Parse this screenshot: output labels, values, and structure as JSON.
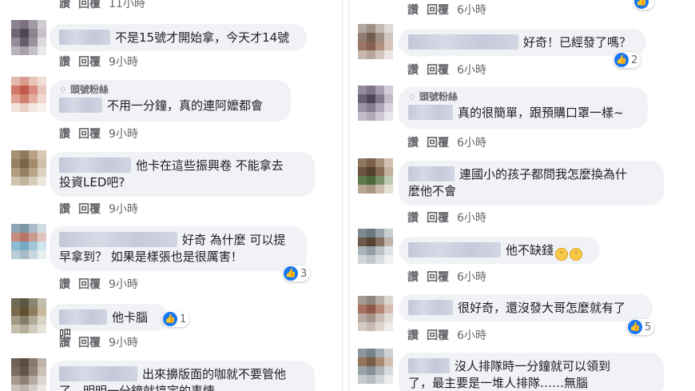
{
  "common": {
    "like": "讚",
    "reply": "回覆",
    "fan_badge": "頭號粉絲"
  },
  "left_column": {
    "top_partial": {
      "time": "11小時"
    },
    "comments": [
      {
        "text": "不是15號才開始拿，今天才14號",
        "time": "9小時"
      },
      {
        "text": "不用一分鐘，真的連阿嬤都會",
        "time": "9小時",
        "badge": true
      },
      {
        "line1": "他卡在這些振興卷 不能拿去",
        "line2": "投資LED吧?",
        "time": "9小時"
      },
      {
        "line1": "好奇 為什麼 可以提",
        "line2": "早拿到？ 如果是樣張也是很厲害！",
        "time": "9小時",
        "reactions": "3"
      },
      {
        "text": "他卡腦吧",
        "time": "9小時",
        "reactions": "1"
      },
      {
        "line1": "出來擤版面的咖就不要管他",
        "line2": "了，明明一分鐘就搞定的事情"
      }
    ]
  },
  "right_column": {
    "top_partial": {
      "time": "6小時"
    },
    "comments": [
      {
        "text": "好奇！已經發了嗎？",
        "time": "6小時",
        "reactions": "2"
      },
      {
        "text": "真的很簡單，跟預購口罩一樣~",
        "time": "6小時",
        "badge": true
      },
      {
        "line1": "連國小的孩子都問我怎麼換為什",
        "line2": "麼他不會",
        "time": "6小時"
      },
      {
        "text": "他不缺錢",
        "time": "6小時"
      },
      {
        "text": "很好奇，還沒發大哥怎麼就有了",
        "time": "6小時",
        "reactions": "5"
      },
      {
        "line1": "沒人排隊時一分鐘就可以領到",
        "line2": "了，最主要是一堆人排隊……無腦"
      }
    ]
  },
  "avatar_colors": [
    [
      "#8a8290",
      "#7d7380",
      "#a19aa3",
      "#cfcbd0",
      "#6e6673",
      "#4f4752",
      "#8c8390",
      "#c7c2c8",
      "#948c98",
      "#665e6b",
      "#9a939d",
      "#dcdadd",
      "#b9b4bb",
      "#a8a2ab",
      "#c4c0c6",
      "#e9e8ea"
    ],
    [
      "#e4b9ad",
      "#d99b8c",
      "#e8c3b8",
      "#f1dcd5",
      "#d0796a",
      "#c25b4d",
      "#d68b7d",
      "#e9c7bd",
      "#dea394",
      "#cf8070",
      "#e2ad9f",
      "#f0d8d0",
      "#f2e3dd",
      "#ead0c7",
      "#f4e6e1",
      "#f9f1ee"
    ],
    [
      "#a79174",
      "#8f7a5f",
      "#b9a283",
      "#d7c9b5",
      "#977f62",
      "#7a634a",
      "#a28a6c",
      "#cdbfa9",
      "#b29c7f",
      "#977f63",
      "#baa58a",
      "#ddd2c2",
      "#cfc2ae",
      "#c2b39c",
      "#d8cdbc",
      "#ece6dc"
    ],
    [
      "#8fa7b5",
      "#7f98a8",
      "#a9bcc7",
      "#d3dee4",
      "#c48d7f",
      "#b97566",
      "#c99a8f",
      "#e0c4bd",
      "#8eb9cf",
      "#76a9c3",
      "#a3c7d8",
      "#d0e4ee",
      "#b9cbd4",
      "#a7bcc8",
      "#c8d6dd",
      "#e6eef2"
    ],
    [
      "#6f6b55",
      "#5c5842",
      "#8a866f",
      "#c0bdaa",
      "#7a6a4c",
      "#5f5036",
      "#8d7c5c",
      "#c6b99c",
      "#a09a82",
      "#857e66",
      "#b1ab95",
      "#d9d5c6",
      "#c4bfae",
      "#b5af9c",
      "#cfcbbd",
      "#e6e3da"
    ],
    [
      "#6f6257",
      "#5a4d43",
      "#877a6f",
      "#bcb2a9",
      "#7d6d60",
      "#655549",
      "#92847a",
      "#c9c0b8",
      "#a59990",
      "#8e8177",
      "#b4aaa2",
      "#dbd5cf",
      "#cbc4be",
      "#bdb5ae",
      "#d5cfca",
      "#ebe8e5"
    ],
    [
      "#b1a6a0",
      "#9d8f86",
      "#c3bab4",
      "#e0dad6",
      "#8f7d71",
      "#735f52",
      "#a08f85",
      "#d0c6c0",
      "#9a7566",
      "#86604f",
      "#b0907f",
      "#d8c5bb",
      "#c7b7ae",
      "#b8a59b",
      "#d3c6bf",
      "#ece5e1"
    ],
    [
      "#93889c",
      "#7f7389",
      "#a89eb0",
      "#d2ccd8",
      "#6b6174",
      "#4f4659",
      "#847a8d",
      "#c0b9c7",
      "#9b91a4",
      "#867c90",
      "#afa6b7",
      "#d8d3dd",
      "#c1bbc7",
      "#b2aab9",
      "#ccc7d1",
      "#e8e5eb"
    ],
    [
      "#8e7660",
      "#7a6049",
      "#a58d76",
      "#d2c2b1",
      "#6c5440",
      "#54402e",
      "#866c56",
      "#c3b09e",
      "#5f7a4e",
      "#4b6a3a",
      "#7a9268",
      "#bccbb0",
      "#b7a692",
      "#a89580",
      "#c9bcab",
      "#e6dfd6"
    ],
    [
      "#7e8a92",
      "#6a7880",
      "#97a2a9",
      "#c9d0d4",
      "#6e5a4c",
      "#564335",
      "#857062",
      "#c0b3a9",
      "#a9b3b9",
      "#929ea5",
      "#bbc3c8",
      "#dfe3e6",
      "#cfd4d7",
      "#c0c7cb",
      "#d9dde0",
      "#eef0f1"
    ],
    [
      "#a59a92",
      "#90857c",
      "#b8aea6",
      "#dad4cf",
      "#a4705f",
      "#8d5848",
      "#b58777",
      "#d7bcb2",
      "#b9a9a0",
      "#a6958b",
      "#c9bcb4",
      "#e3dbd6",
      "#d3c9c3",
      "#c6bab3",
      "#ddd5d0",
      "#efebe8"
    ],
    [
      "#8d969c",
      "#77828a",
      "#a4acb1",
      "#cfd3d6",
      "#94765c",
      "#7a5d45",
      "#a88a72",
      "#d2c1b2",
      "#9aa3a8",
      "#86909a",
      "#adb4b9",
      "#d6dadc",
      "#c4c9cc",
      "#b6bcbf",
      "#d0d4d6",
      "#e9ebec"
    ],
    [
      "#7b7e86",
      "#676a73",
      "#92959c",
      "#c5c7cb",
      "#8a8d95",
      "#72757e",
      "#a0a3aa",
      "#cdcfd2",
      "#5f6a75",
      "#4b5661",
      "#7a848e",
      "#b8bec4",
      "#aeb2b8",
      "#9fa4aa",
      "#c2c5ca",
      "#e1e3e5"
    ],
    [
      "#8d8f96",
      "#76797f",
      "#a3a5ab",
      "#cdced2",
      "#6f7279",
      "#575a60",
      "#868990",
      "#bfc1c5",
      "#989aa0",
      "#82858b",
      "#acaeb3",
      "#d3d4d7",
      "#c0c2c6",
      "#b2b4b9",
      "#cfd0d3",
      "#e8e9ea"
    ]
  ]
}
